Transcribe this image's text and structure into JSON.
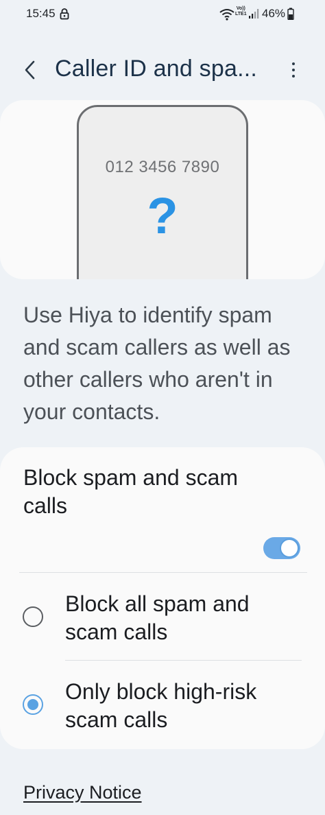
{
  "status_bar": {
    "time": "15:45",
    "volte_line1": "Vo))",
    "volte_line2": "LTE1",
    "battery": "46%"
  },
  "header": {
    "title": "Caller ID and spa...",
    "back_icon": "chevron-left-icon",
    "more_icon": "more-vertical-icon"
  },
  "illustration": {
    "phone_number": "012 3456 7890",
    "symbol": "?"
  },
  "description": "Use Hiya to identify spam and scam callers as well as other callers who aren't in your contacts.",
  "settings": {
    "block_title": "Block spam and scam calls",
    "toggle_on": true,
    "options": [
      {
        "label": "Block all spam and scam calls",
        "selected": false
      },
      {
        "label": "Only block high-risk scam calls",
        "selected": true
      }
    ]
  },
  "privacy_notice": "Privacy Notice",
  "colors": {
    "accent": "#2b93e4",
    "toggle": "#6aa9e6",
    "background": "#eef2f6",
    "title": "#1c3249"
  }
}
